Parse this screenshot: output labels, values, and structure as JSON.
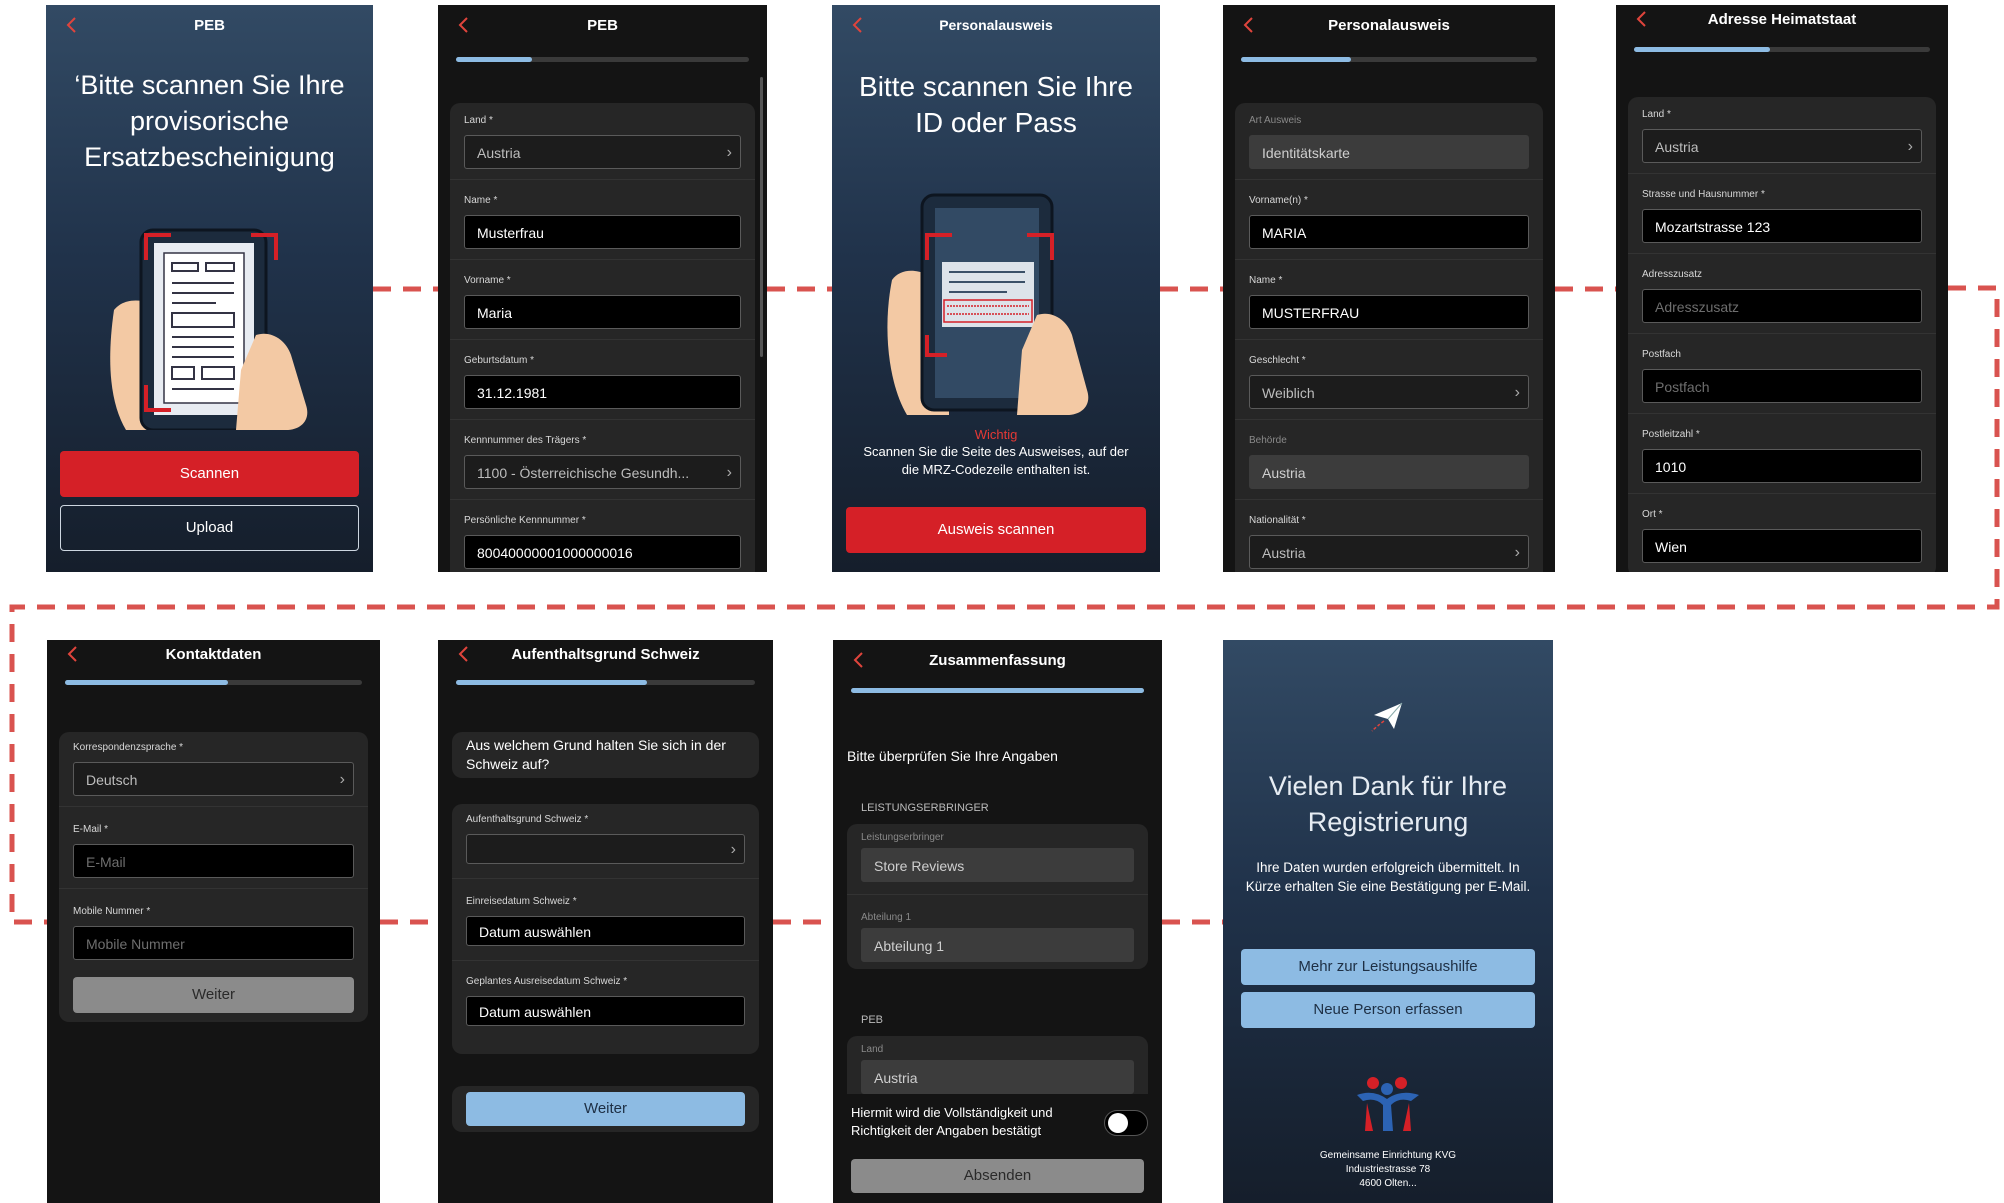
{
  "colors": {
    "accent_red": "#d52027",
    "accent_blue": "#8dbbe3",
    "flow_line": "#d9534f",
    "screen_dark": "#141414"
  },
  "screens": {
    "s1": {
      "title": "PEB",
      "headline": "‘Bitte scannen Sie Ihre provisorische Ersatzbescheinigung",
      "scan_button": "Scannen",
      "upload_button": "Upload"
    },
    "s2": {
      "title": "PEB",
      "fields": [
        {
          "label": "Land *",
          "value": "Austria"
        },
        {
          "label": "Name *",
          "value": "Musterfrau"
        },
        {
          "label": "Vorname *",
          "value": "Maria"
        },
        {
          "label": "Geburtsdatum *",
          "value": "31.12.1981"
        },
        {
          "label": "Kennnummer des Trägers *",
          "value": "1100 - Österreichische Gesundh..."
        },
        {
          "label": "Persönliche Kennnummer *",
          "value": "80040000001000000016"
        }
      ]
    },
    "s3": {
      "title": "Personalausweis",
      "headline": "Bitte scannen Sie Ihre ID oder Pass",
      "important": "Wichtig",
      "instruction": "Scannen Sie die Seite des Ausweises, auf der die MRZ-Codezeile enthalten ist.",
      "scan_button": "Ausweis scannen"
    },
    "s4": {
      "title": "Personalausweis",
      "fields": [
        {
          "label": "Art Ausweis",
          "value": "Identitätskarte"
        },
        {
          "label": "Vorname(n) *",
          "value": "MARIA"
        },
        {
          "label": "Name *",
          "value": "MUSTERFRAU"
        },
        {
          "label": "Geschlecht *",
          "value": "Weiblich"
        },
        {
          "label": "Behörde",
          "value": "Austria"
        },
        {
          "label": "Nationalität *",
          "value": "Austria"
        }
      ]
    },
    "s5": {
      "title": "Adresse Heimatstaat",
      "fields": [
        {
          "label": "Land *",
          "value": "Austria"
        },
        {
          "label": "Strasse und Hausnummer *",
          "value": "Mozartstrasse 123"
        },
        {
          "label": "Adresszusatz",
          "placeholder": "Adresszusatz"
        },
        {
          "label": "Postfach",
          "placeholder": "Postfach"
        },
        {
          "label": "Postleitzahl *",
          "value": "1010"
        },
        {
          "label": "Ort *",
          "value": "Wien"
        }
      ]
    },
    "s6": {
      "title": "Kontaktdaten",
      "fields": [
        {
          "label": "Korrespondenzsprache *",
          "value": "Deutsch"
        },
        {
          "label": "E-Mail *",
          "placeholder": "E-Mail"
        },
        {
          "label": "Mobile Nummer *",
          "placeholder": "Mobile Nummer"
        }
      ],
      "next_button": "Weiter"
    },
    "s7": {
      "title": "Aufenthaltsgrund Schweiz",
      "question": "Aus welchem Grund halten Sie sich in der Schweiz auf?",
      "fields": [
        {
          "label": "Aufenthaltsgrund Schweiz *",
          "value": ""
        },
        {
          "label": "Einreisedatum Schweiz *",
          "value": "Datum auswählen"
        },
        {
          "label": "Geplantes Ausreisedatum Schweiz *",
          "value": "Datum auswählen"
        }
      ],
      "next_button": "Weiter"
    },
    "s8": {
      "title": "Zusammenfassung",
      "intro": "Bitte überprüfen Sie Ihre Angaben",
      "section1": "LEISTUNGSERBRINGER",
      "fields1": [
        {
          "label": "Leistungserbringer",
          "value": "Store Reviews"
        },
        {
          "label": "Abteilung 1",
          "value": "Abteilung 1"
        }
      ],
      "section2": "PEB",
      "fields2": [
        {
          "label": "Land",
          "value": "Austria"
        }
      ],
      "confirm_text": "Hiermit wird die Vollständigkeit und Richtigkeit der Angaben bestätigt",
      "confirm_checked": false,
      "submit_button": "Absenden"
    },
    "s9": {
      "title": "Vielen Dank für Ihre Registrierung",
      "message": "Ihre Daten wurden erfolgreich übermittelt. In Kürze erhalten Sie eine Bestätigung per E-Mail.",
      "more_button": "Mehr zur Leistungsaushilfe",
      "new_person_button": "Neue Person erfassen",
      "footer_line1": "Gemeinsame Einrichtung KVG",
      "footer_line2": "Industriestrasse 78",
      "footer_line3": "4600 Olten..."
    }
  }
}
